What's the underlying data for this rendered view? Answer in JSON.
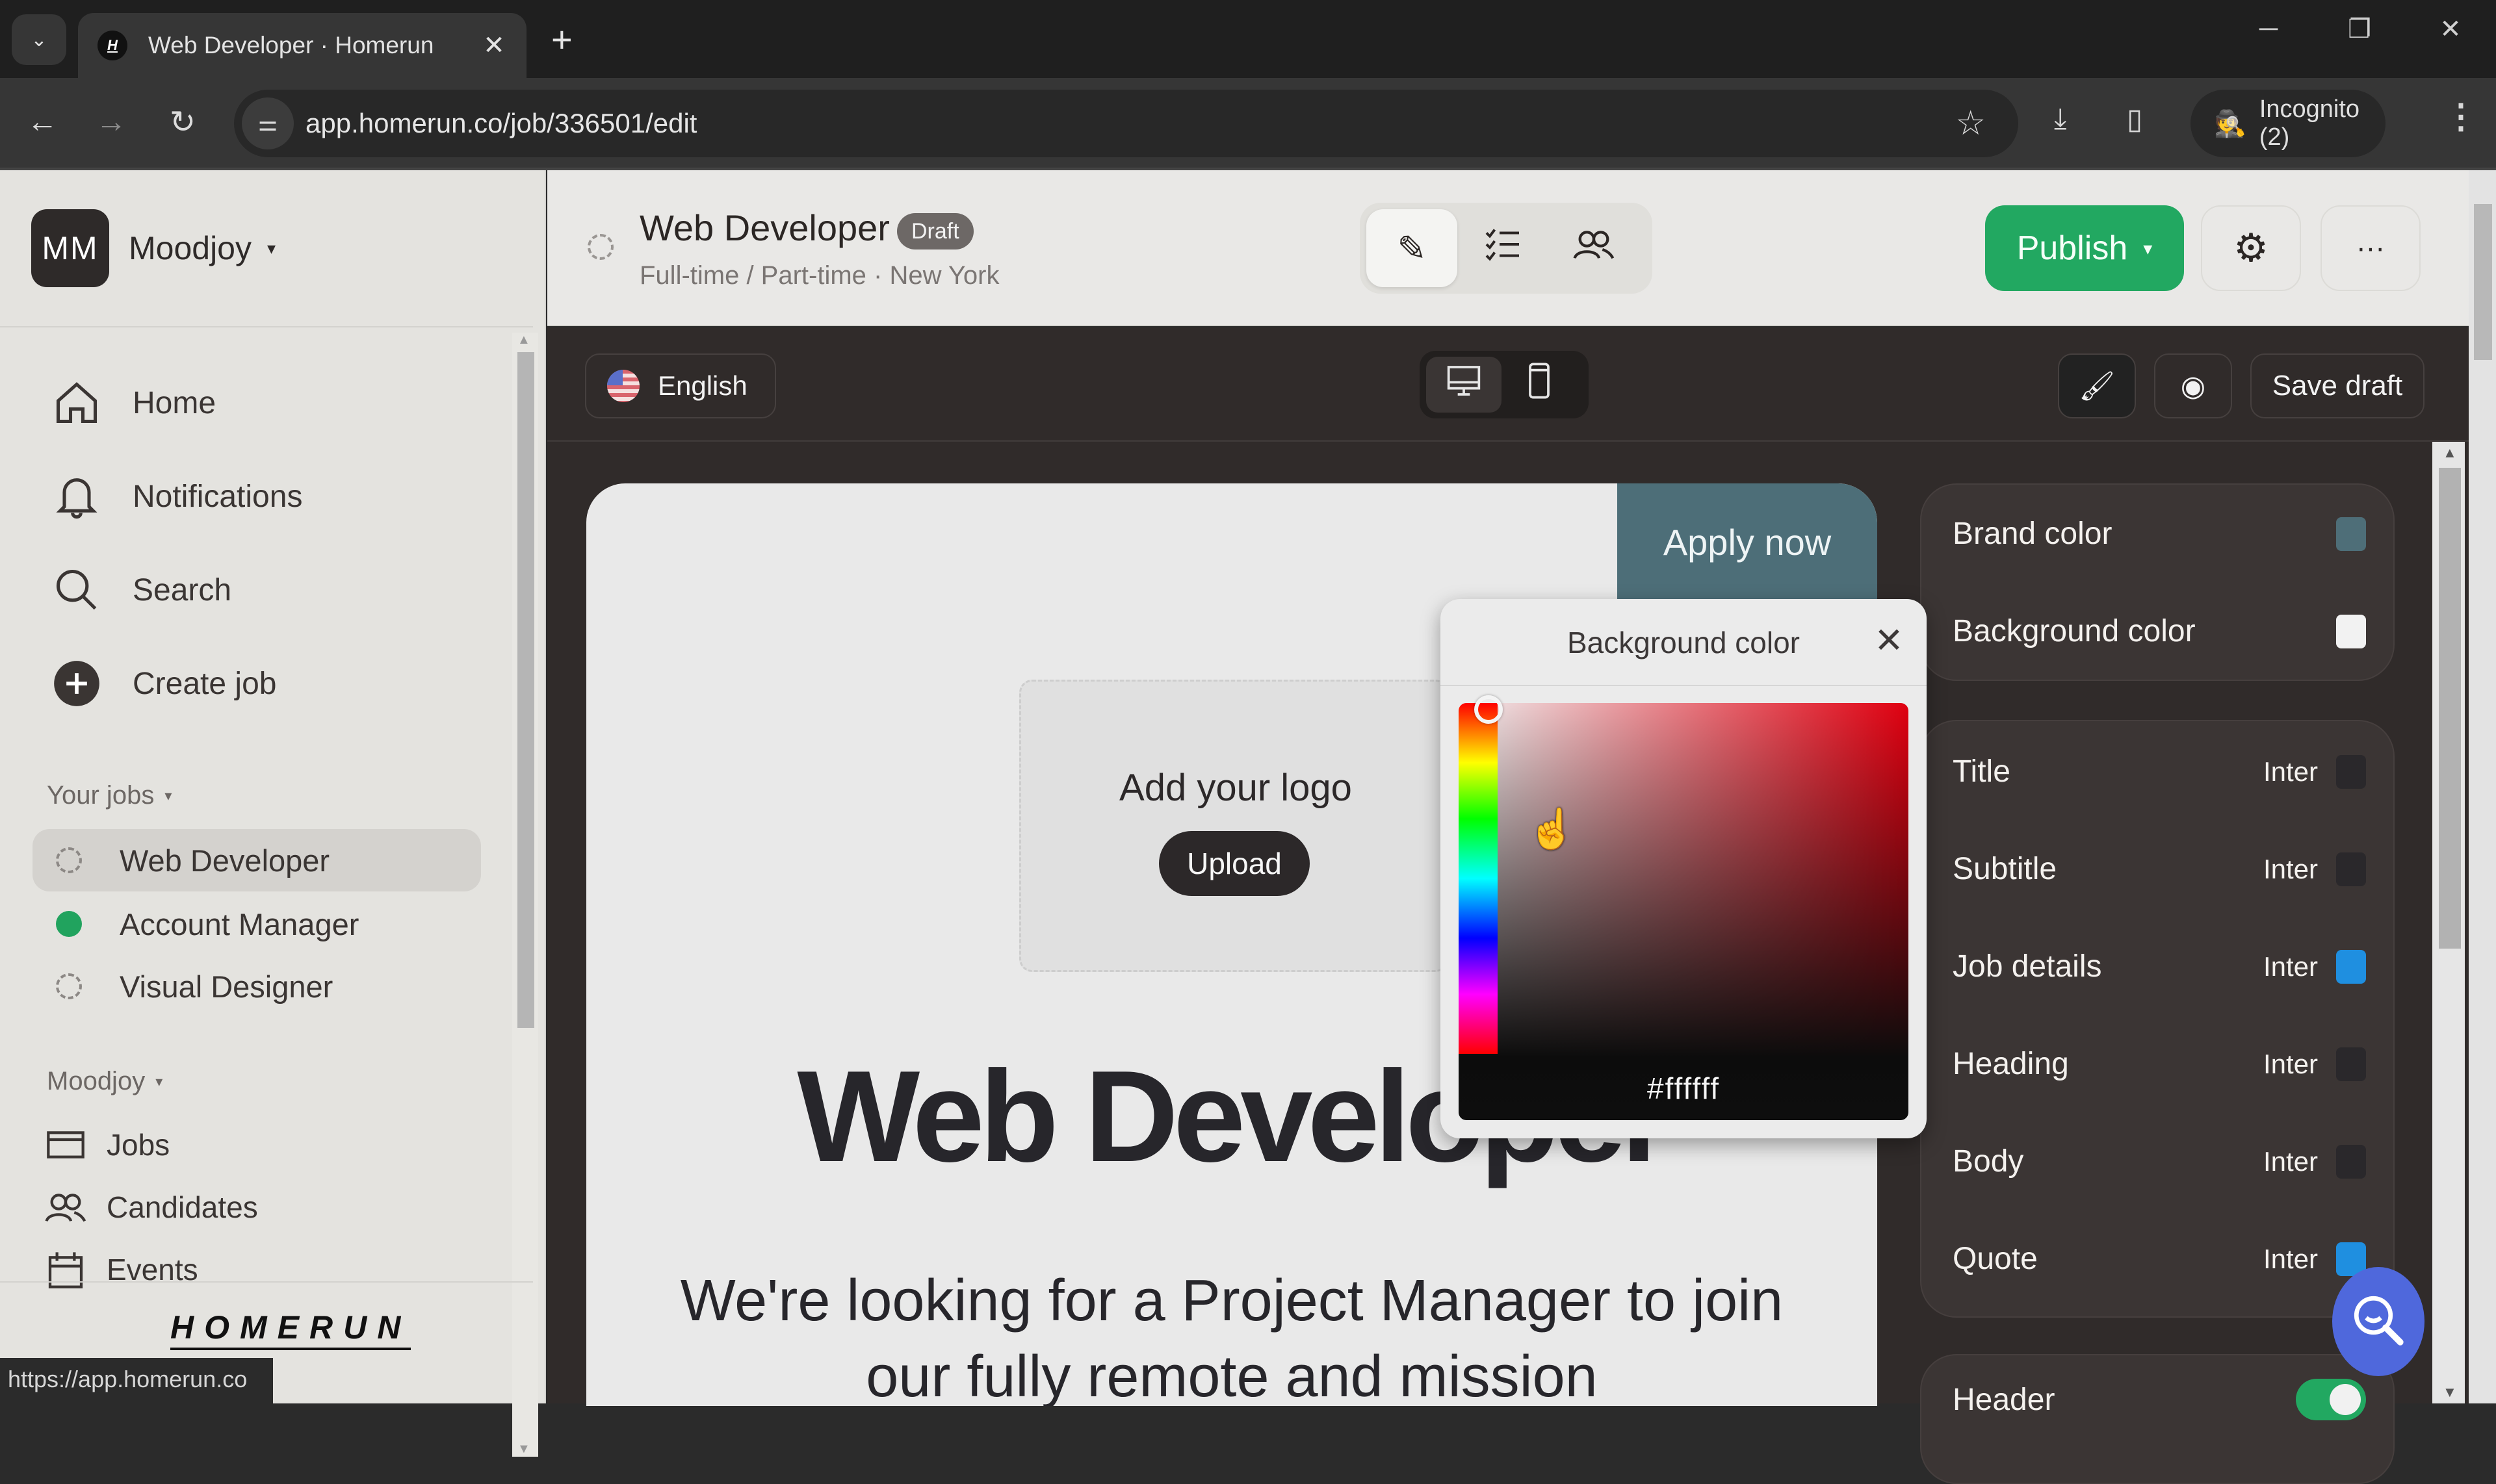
{
  "browser": {
    "tab_title": "Web Developer · Homerun",
    "favicon_letter": "H",
    "url": "app.homerun.co/job/336501/edit",
    "incognito_label": "Incognito (2)",
    "status_url": "https://app.homerun.co"
  },
  "icons": {
    "tab_search": "⌄",
    "close": "✕",
    "new_tab": "+",
    "minimize": "─",
    "restore": "❐",
    "back": "←",
    "forward": "→",
    "reload": "↻",
    "site_info": "⚌",
    "star": "☆",
    "download": "⤓",
    "sidepanel": "▯",
    "incognito": "🕵",
    "kebab": "⋮",
    "caret": "▾",
    "pencil": "✎",
    "checklist": "☰",
    "people": "👥",
    "gear": "⚙",
    "more": "···",
    "desktop": "🖥",
    "mobile": "▯",
    "brush": "🖌",
    "eye": "◉",
    "hand_cursor": "☝"
  },
  "sidebar": {
    "org_initials": "MM",
    "org_name": "Moodjoy",
    "primary_nav": [
      {
        "label": "Home",
        "icon": "home-icon"
      },
      {
        "label": "Notifications",
        "icon": "bell-icon"
      },
      {
        "label": "Search",
        "icon": "search-icon"
      },
      {
        "label": "Create job",
        "icon": "plus-circle-icon"
      }
    ],
    "your_jobs_label": "Your jobs",
    "jobs": [
      {
        "label": "Web Developer",
        "status": "draft",
        "active": true
      },
      {
        "label": "Account Manager",
        "status": "published",
        "active": false
      },
      {
        "label": "Visual Designer",
        "status": "draft",
        "active": false
      }
    ],
    "org_section_label": "Moodjoy",
    "org_links": [
      {
        "label": "Jobs",
        "icon": "jobs-icon"
      },
      {
        "label": "Candidates",
        "icon": "candidates-icon"
      },
      {
        "label": "Events",
        "icon": "calendar-icon"
      }
    ],
    "brand": "HOMERUN"
  },
  "job_header": {
    "title": "Web Developer",
    "badge": "Draft",
    "meta": "Full-time / Part-time · New York",
    "publish_label": "Publish"
  },
  "editor_toolbar": {
    "language": "English",
    "save_draft_label": "Save draft"
  },
  "preview": {
    "apply_label": "Apply now",
    "logo_prompt": "Add your logo",
    "upload_label": "Upload",
    "title": "Web Developer",
    "lead": "We're looking for a Project Manager to join our fully remote and mission"
  },
  "color_picker": {
    "title": "Background color",
    "hex": "#ffffff"
  },
  "style_panel": {
    "colors": [
      {
        "label": "Brand color",
        "swatch": "#4e6e78"
      },
      {
        "label": "Background color",
        "swatch": "#f2f2f2"
      }
    ],
    "typography": [
      {
        "label": "Title",
        "font": "Inter",
        "swatch": "#2a282b"
      },
      {
        "label": "Subtitle",
        "font": "Inter",
        "swatch": "#2a282b"
      },
      {
        "label": "Job details",
        "font": "Inter",
        "swatch": "#1f8fe0"
      },
      {
        "label": "Heading",
        "font": "Inter",
        "swatch": "#2a282b"
      },
      {
        "label": "Body",
        "font": "Inter",
        "swatch": "#2a282b"
      },
      {
        "label": "Quote",
        "font": "Inter",
        "swatch": "#1f8fe0"
      }
    ],
    "sections": [
      {
        "label": "Header",
        "enabled": true
      }
    ]
  }
}
